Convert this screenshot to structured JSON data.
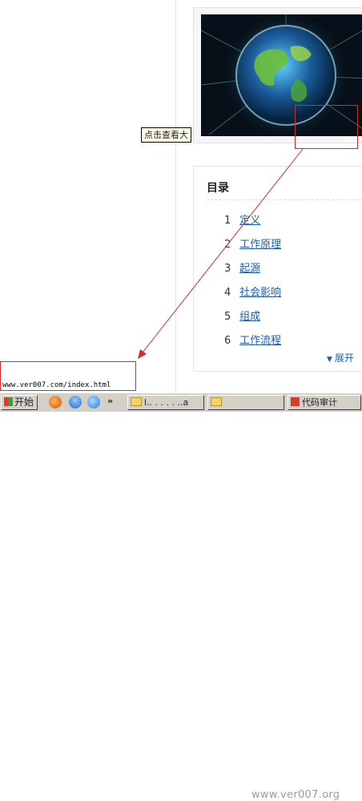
{
  "tooltip": {
    "text": "点击查看大"
  },
  "toc": {
    "title": "目录",
    "items": [
      {
        "num": "1",
        "label": "定义"
      },
      {
        "num": "2",
        "label": "工作原理"
      },
      {
        "num": "3",
        "label": "起源"
      },
      {
        "num": "4",
        "label": "社会影响"
      },
      {
        "num": "5",
        "label": "组成"
      },
      {
        "num": "6",
        "label": "工作流程"
      }
    ],
    "expand_label": "展开"
  },
  "statusbar": {
    "url": "www.ver007.com/index.html"
  },
  "taskbar": {
    "start_label": "开始",
    "quicklaunch_more": "»",
    "tasks": [
      {
        "label": "l.. . . . . ..a"
      },
      {
        "label": ""
      },
      {
        "label": "代码审计"
      }
    ],
    "watermark": "www.ver007.org"
  },
  "colors": {
    "annotation": "#d42b2b",
    "link": "#1b5fa8"
  },
  "icons": [
    "globe-image",
    "firefox-icon",
    "qq-icon",
    "ie-icon",
    "folder-icon",
    "app-icon",
    "windows-logo-icon"
  ]
}
